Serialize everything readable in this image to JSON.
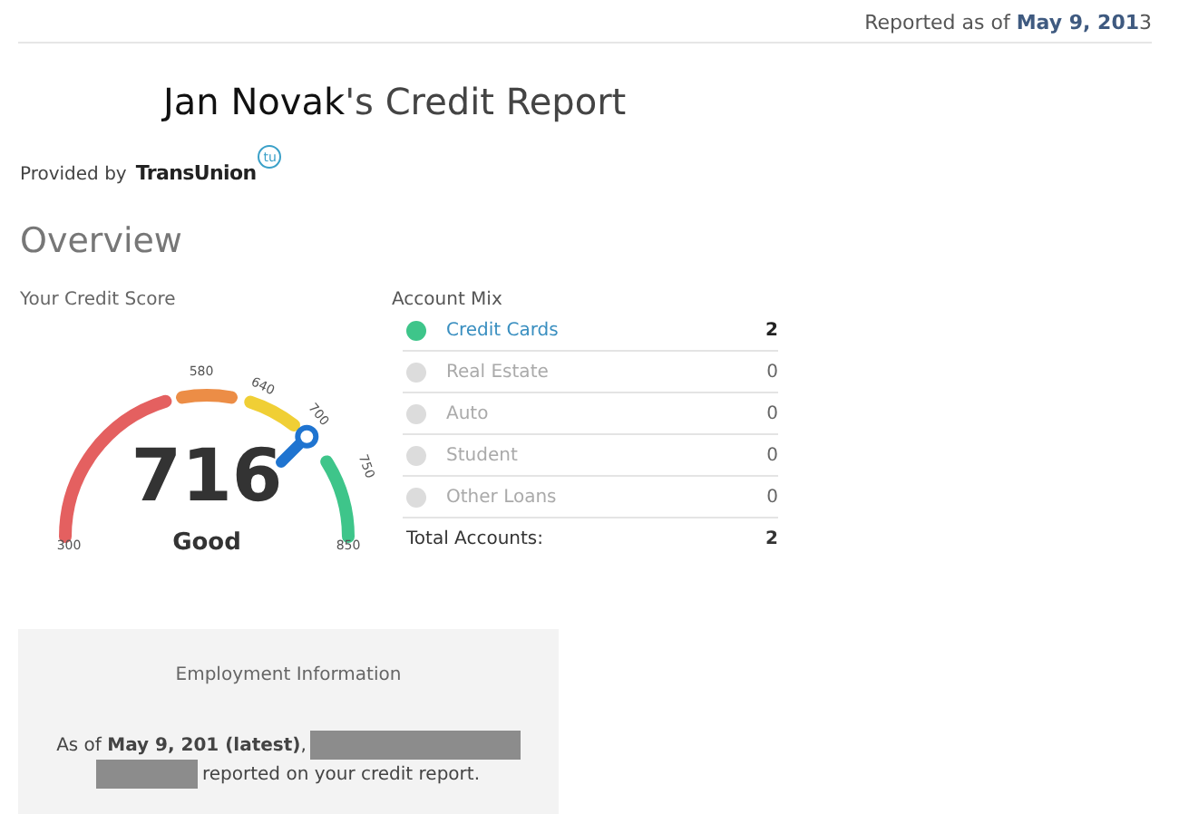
{
  "header": {
    "reported": "Reported as of **May  9, 201**3"
  },
  "title": "**Jan Novak**'s Credit Report",
  "provider": {
    "label": "Provided by",
    "brand": "TransUnion",
    "badge": "tu"
  },
  "overview": "Overview",
  "credit_score": {
    "label": "Your Credit Score",
    "score": "716",
    "rating": "Good",
    "ticks": [
      "300",
      "580",
      "640",
      "700",
      "750",
      "850"
    ]
  },
  "account_mix": {
    "title": "Account Mix",
    "items": [
      {
        "name": "Credit Cards",
        "count": "2",
        "active": true
      },
      {
        "name": "Real Estate",
        "count": "0",
        "active": false
      },
      {
        "name": "Auto",
        "count": "0",
        "active": false
      },
      {
        "name": "Student",
        "count": "0",
        "active": false
      },
      {
        "name": "Other Loans",
        "count": "0",
        "active": false
      }
    ],
    "total": {
      "label": "Total Accounts:",
      "count": "2"
    }
  },
  "employment": {
    "title": "Employment Information",
    "line_1": "As of **May  9, 201  (latest)**,",
    "line_2": "reported on your credit report."
  }
}
